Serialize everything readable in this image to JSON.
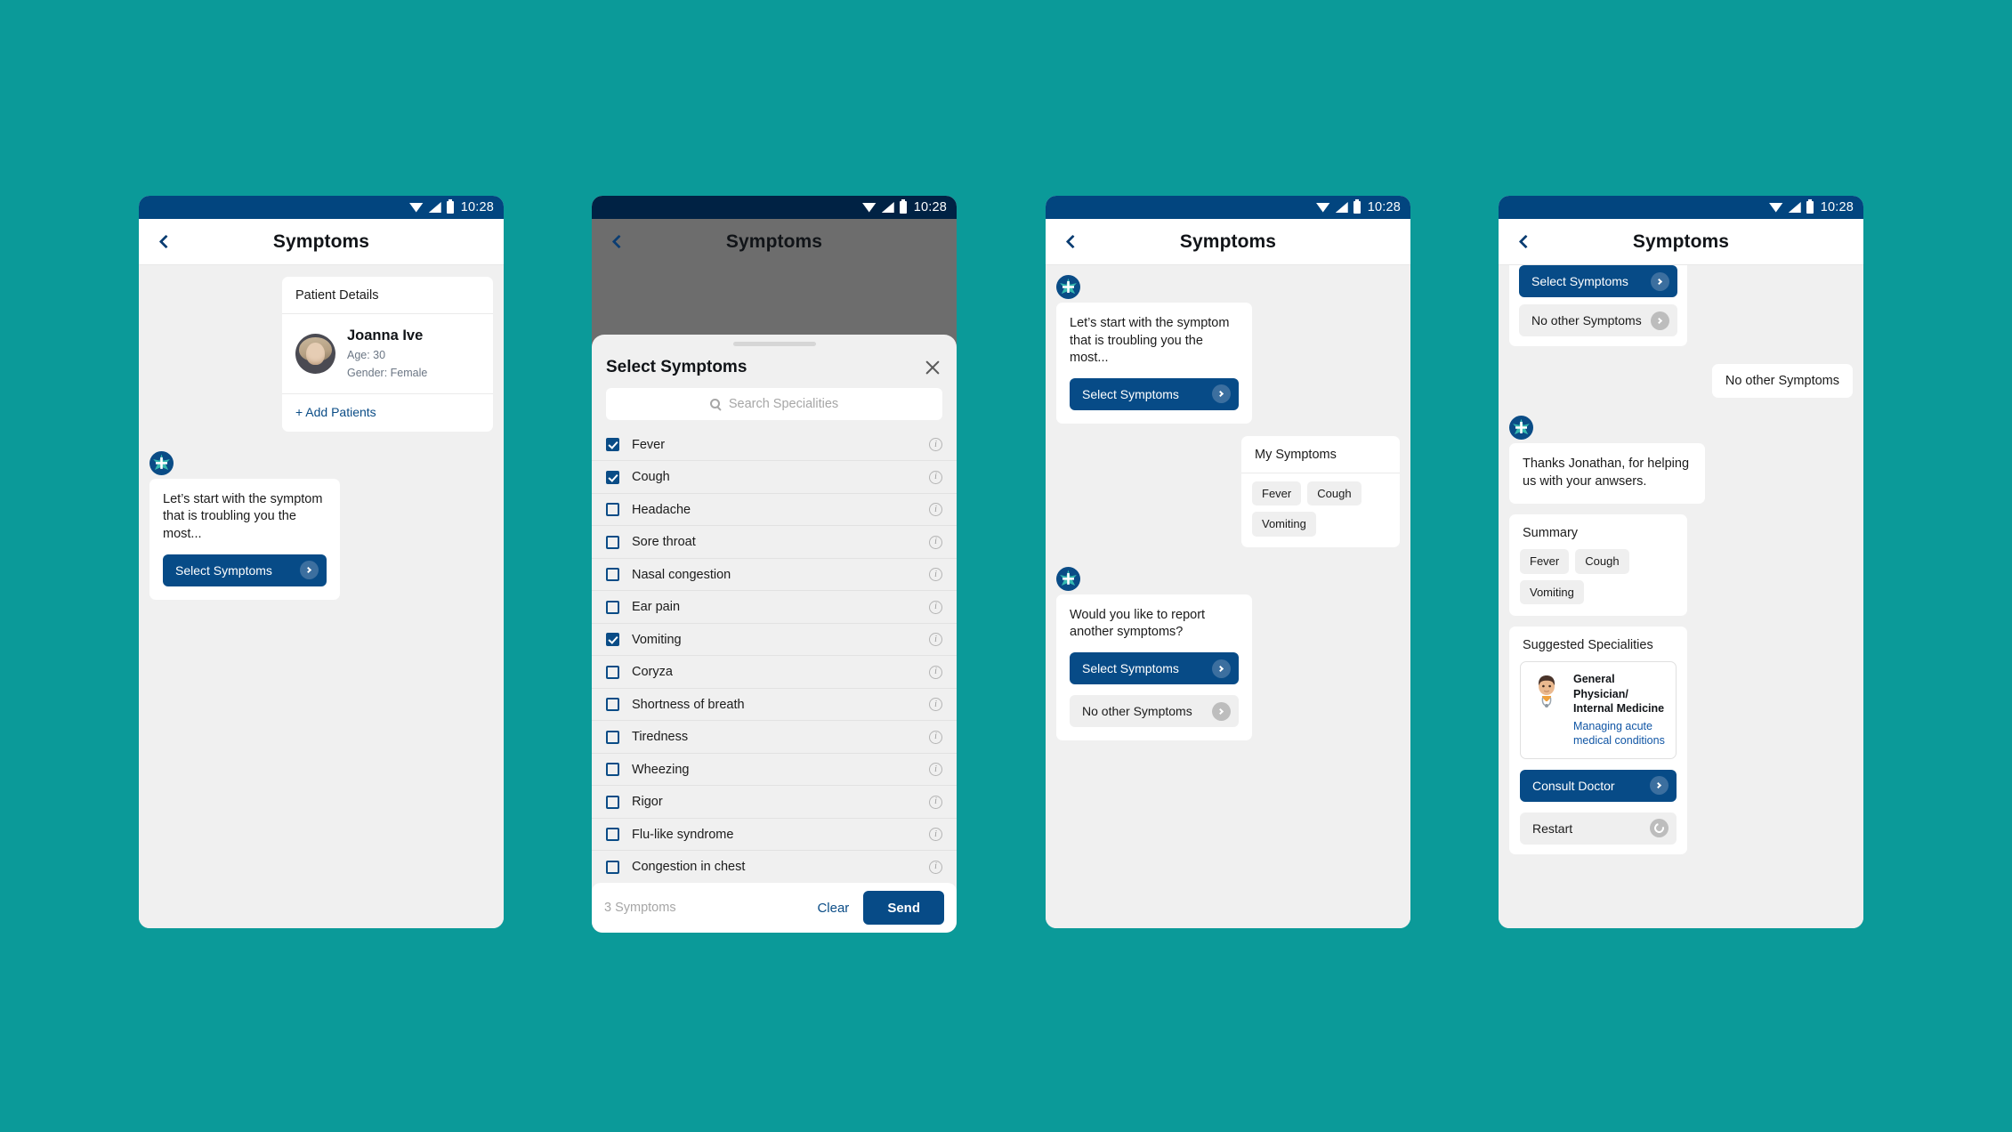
{
  "theme": {
    "background": "#0b9a99",
    "primary": "#074b87",
    "statusbar": "#02457f",
    "statusbar_dim": "#002244",
    "link": "#0a4c86",
    "chat_bg": "#f0f0f0"
  },
  "statusbar": {
    "time": "10:28",
    "wifi_icon": "wifi-icon",
    "signal_icon": "signal-icon",
    "battery_icon": "battery-icon"
  },
  "appbar": {
    "title": "Symptoms",
    "back_icon": "chevron-left-icon"
  },
  "phone1": {
    "patient_card": {
      "header": "Patient Details",
      "name": "Joanna Ive",
      "age": "Age: 30",
      "gender": "Gender: Female",
      "add_label": "+ Add Patients"
    },
    "bot_message": {
      "text": "Let’s start with the symptom that is troubling you the most...",
      "primary_action": "Select Symptoms"
    }
  },
  "phone2": {
    "sheet": {
      "title": "Select Symptoms",
      "close_icon": "close-icon",
      "grabber": "drag-handle",
      "search_placeholder": "Search Specialities",
      "search_value": "",
      "search_icon": "search-icon",
      "info_icon": "info-icon",
      "symptoms": [
        {
          "label": "Fever",
          "checked": true
        },
        {
          "label": "Cough",
          "checked": true
        },
        {
          "label": "Headache",
          "checked": false
        },
        {
          "label": "Sore throat",
          "checked": false
        },
        {
          "label": "Nasal congestion",
          "checked": false
        },
        {
          "label": "Ear pain",
          "checked": false
        },
        {
          "label": "Vomiting",
          "checked": true
        },
        {
          "label": "Coryza",
          "checked": false
        },
        {
          "label": "Shortness of breath",
          "checked": false
        },
        {
          "label": "Tiredness",
          "checked": false
        },
        {
          "label": "Wheezing",
          "checked": false
        },
        {
          "label": "Rigor",
          "checked": false
        },
        {
          "label": "Flu-like syndrome",
          "checked": false
        },
        {
          "label": "Congestion in chest",
          "checked": false
        }
      ],
      "footer": {
        "count": "3 Symptoms",
        "clear": "Clear",
        "send": "Send"
      }
    }
  },
  "phone3": {
    "bot_message_1": {
      "text": "Let’s start with the symptom that is troubling you the most...",
      "primary_action": "Select Symptoms"
    },
    "my_symptoms": {
      "header": "My Symptoms",
      "chips": [
        "Fever",
        "Cough",
        "Vomiting"
      ]
    },
    "bot_message_2": {
      "text": "Would you like to report another symptoms?",
      "primary_action": "Select Symptoms",
      "secondary_action": "No other Symptoms"
    }
  },
  "phone4": {
    "clipped_card": {
      "primary_action": "Select Symptoms",
      "secondary_action": "No other Symptoms"
    },
    "user_reply": "No other Symptoms",
    "thanks_message": "Thanks Jonathan, for helping us with your anwsers.",
    "summary": {
      "header": "Summary",
      "chips": [
        "Fever",
        "Cough",
        "Vomiting"
      ]
    },
    "specialities": {
      "header": "Suggested Specialities",
      "doctor_icon": "doctor-avatar-icon",
      "item": {
        "name": "General Physician/ Internal Medicine",
        "desc": "Managing acute medical conditions"
      },
      "consult_action": "Consult Doctor",
      "restart_action": "Restart",
      "restart_icon": "refresh-icon"
    }
  }
}
